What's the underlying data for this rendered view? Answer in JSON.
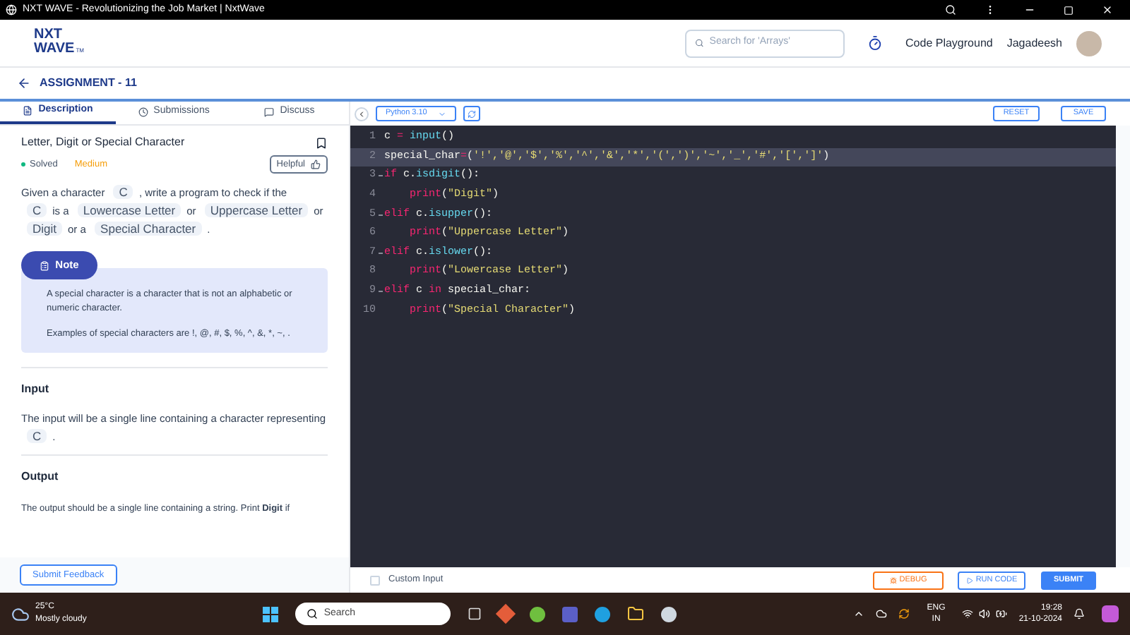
{
  "window": {
    "title": "NXT WAVE - Revolutionizing the Job Market | NxtWave"
  },
  "header": {
    "logo_line1": "NXT",
    "logo_line2": "WAVE",
    "logo_tm": "TM",
    "search": {
      "placeholder": "Search for 'Arrays'"
    },
    "playground": "Code Playground",
    "user": "Jagadeesh"
  },
  "assignment": {
    "title": "ASSIGNMENT - 11"
  },
  "tabs": [
    {
      "label": "Description",
      "selected": true
    },
    {
      "label": "Submissions",
      "selected": false
    },
    {
      "label": "Discuss",
      "selected": false
    }
  ],
  "problem": {
    "title": "Letter, Digit or Special Character",
    "status": "Solved",
    "difficulty": "Medium",
    "helpful": "Helpful",
    "statement": [
      {
        "kind": "text",
        "text": "Given a character"
      },
      {
        "kind": "code",
        "text": "C"
      },
      {
        "kind": "text",
        "text": ", write a program to check if the"
      },
      {
        "kind": "code",
        "text": "C"
      },
      {
        "kind": "text",
        "text": "is a"
      },
      {
        "kind": "code",
        "text": "Lowercase Letter"
      },
      {
        "kind": "text",
        "text": "or"
      },
      {
        "kind": "code",
        "text": "Uppercase Letter"
      },
      {
        "kind": "text",
        "text": "or"
      },
      {
        "kind": "code",
        "text": "Digit"
      },
      {
        "kind": "text",
        "text": "or a"
      },
      {
        "kind": "code",
        "text": "Special Character"
      },
      {
        "kind": "text",
        "text": "."
      }
    ],
    "note": {
      "label": "Note",
      "paragraphs": [
        "A special character is a character that is not an alphabetic or numeric character.",
        "Examples of special characters are !, @, #, $, %, ^, &, *, ~, ."
      ]
    },
    "input_heading": "Input",
    "input_text": [
      {
        "kind": "text",
        "text": "The input will be a single line containing a character representing"
      },
      {
        "kind": "code",
        "text": "C"
      },
      {
        "kind": "text",
        "text": "."
      }
    ],
    "output_heading": "Output",
    "output_text": "The output should be a single line containing a string. Print **Digit** if"
  },
  "feedback": "Submit Feedback",
  "editor": {
    "language": "Python 3.10",
    "reset": "RESET",
    "save": "SAVE",
    "lines": [
      {
        "n": "1",
        "fold": false,
        "selected": false,
        "tokens": [
          {
            "kind": "plain",
            "text": "c "
          },
          {
            "kind": "op",
            "text": "="
          },
          {
            "kind": "func",
            "text": " input"
          },
          {
            "kind": "plain",
            "text": "()"
          }
        ]
      },
      {
        "n": "2",
        "fold": false,
        "selected": true,
        "tokens": [
          {
            "kind": "plain",
            "text": "special_char"
          },
          {
            "kind": "op",
            "text": "="
          },
          {
            "kind": "plain",
            "text": "("
          },
          {
            "kind": "string",
            "text": "'!','@','$','%','^','&','*','(',')','~','_','#','[',']'"
          },
          {
            "kind": "plain",
            "text": ")"
          }
        ]
      },
      {
        "n": "3",
        "fold": true,
        "selected": false,
        "tokens": [
          {
            "kind": "keyword",
            "text": "if"
          },
          {
            "kind": "plain",
            "text": " c."
          },
          {
            "kind": "func",
            "text": "isdigit"
          },
          {
            "kind": "plain",
            "text": "():"
          }
        ]
      },
      {
        "n": "4",
        "fold": false,
        "selected": false,
        "indent": true,
        "tokens": [
          {
            "kind": "keyword",
            "text": "print"
          },
          {
            "kind": "plain",
            "text": "("
          },
          {
            "kind": "string",
            "text": "\"Digit\""
          },
          {
            "kind": "plain",
            "text": ")"
          }
        ]
      },
      {
        "n": "5",
        "fold": true,
        "selected": false,
        "tokens": [
          {
            "kind": "keyword",
            "text": "elif"
          },
          {
            "kind": "plain",
            "text": " c."
          },
          {
            "kind": "func",
            "text": "isupper"
          },
          {
            "kind": "plain",
            "text": "():"
          }
        ]
      },
      {
        "n": "6",
        "fold": false,
        "selected": false,
        "indent": true,
        "tokens": [
          {
            "kind": "keyword",
            "text": "print"
          },
          {
            "kind": "plain",
            "text": "("
          },
          {
            "kind": "string",
            "text": "\"Uppercase Letter\""
          },
          {
            "kind": "plain",
            "text": ")"
          }
        ]
      },
      {
        "n": "7",
        "fold": true,
        "selected": false,
        "tokens": [
          {
            "kind": "keyword",
            "text": "elif"
          },
          {
            "kind": "plain",
            "text": " c."
          },
          {
            "kind": "func",
            "text": "islower"
          },
          {
            "kind": "plain",
            "text": "():"
          }
        ]
      },
      {
        "n": "8",
        "fold": false,
        "selected": false,
        "indent": true,
        "tokens": [
          {
            "kind": "keyword",
            "text": "print"
          },
          {
            "kind": "plain",
            "text": "("
          },
          {
            "kind": "string",
            "text": "\"Lowercase Letter\""
          },
          {
            "kind": "plain",
            "text": ")"
          }
        ]
      },
      {
        "n": "9",
        "fold": true,
        "selected": false,
        "tokens": [
          {
            "kind": "keyword",
            "text": "elif"
          },
          {
            "kind": "plain",
            "text": " c "
          },
          {
            "kind": "keyword",
            "text": "in"
          },
          {
            "kind": "plain",
            "text": " special_char:"
          }
        ]
      },
      {
        "n": "10",
        "fold": false,
        "selected": false,
        "indent": true,
        "tokens": [
          {
            "kind": "keyword",
            "text": "print"
          },
          {
            "kind": "plain",
            "text": "("
          },
          {
            "kind": "string",
            "text": "\"Special Character\""
          },
          {
            "kind": "plain",
            "text": ")"
          }
        ]
      }
    ],
    "custom_input": {
      "label": "Custom Input",
      "checked": false
    },
    "debug": "DEBUG",
    "run": "RUN CODE",
    "submit": "SUBMIT"
  },
  "taskbar": {
    "temperature": "25°C",
    "weather": "Mostly cloudy",
    "search": {
      "placeholder": "Search"
    },
    "lang1": "ENG",
    "lang2": "IN",
    "time": "19:28",
    "date": "21-10-2024"
  }
}
